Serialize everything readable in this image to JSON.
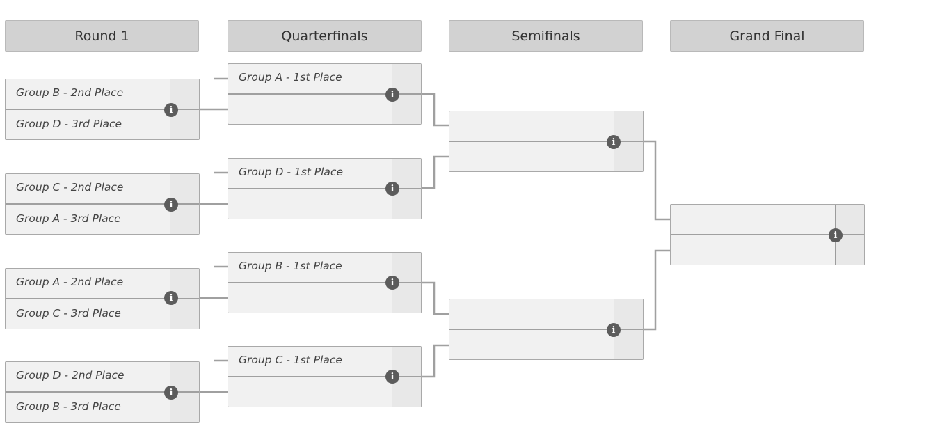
{
  "rounds": [
    {
      "label": "Round 1"
    },
    {
      "label": "Quarterfinals"
    },
    {
      "label": "Semifinals"
    },
    {
      "label": "Grand Final"
    }
  ],
  "round1": [
    {
      "top": "Group B - 2nd Place",
      "bottom": "Group D - 3rd Place"
    },
    {
      "top": "Group C - 2nd Place",
      "bottom": "Group A - 3rd Place"
    },
    {
      "top": "Group A - 2nd Place",
      "bottom": "Group C - 3rd Place"
    },
    {
      "top": "Group D - 2nd Place",
      "bottom": "Group B - 3rd Place"
    }
  ],
  "quarterfinals": [
    {
      "top": "Group A - 1st Place",
      "bottom": ""
    },
    {
      "top": "Group D - 1st Place",
      "bottom": ""
    },
    {
      "top": "Group B - 1st Place",
      "bottom": ""
    },
    {
      "top": "Group C - 1st Place",
      "bottom": ""
    }
  ],
  "semifinals": [
    {
      "top": "",
      "bottom": ""
    },
    {
      "top": "",
      "bottom": ""
    }
  ],
  "final": [
    {
      "top": "",
      "bottom": ""
    }
  ],
  "icons": {
    "match_info": "info-icon",
    "info_glyph": "i"
  },
  "colors": {
    "header_bg": "#d2d2d2",
    "match_bg": "#f1f1f1",
    "line": "#a0a0a0",
    "info_icon": "#5c5c5c"
  }
}
